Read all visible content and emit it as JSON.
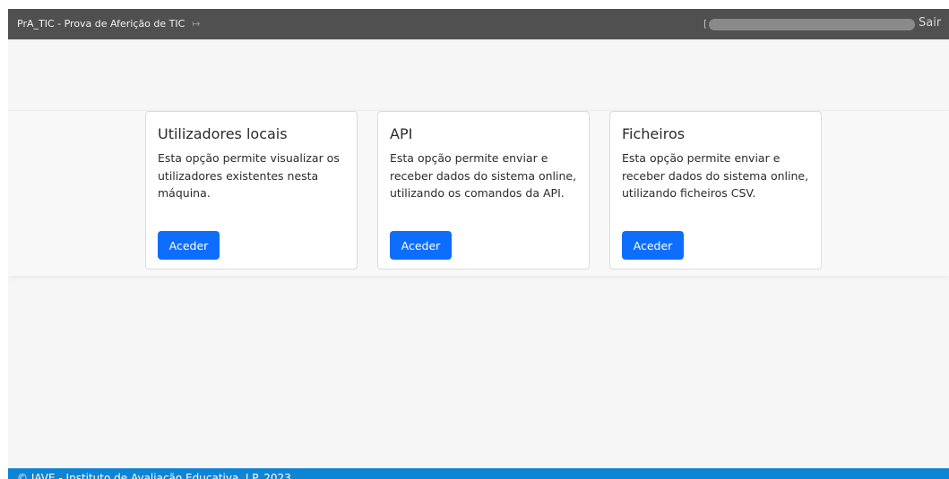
{
  "navbar": {
    "brand": "PrA_TIC - Prova de Aferição de TIC",
    "brand_icon": "sign-out-icon",
    "user_icon": "user-icon",
    "logout_label": "Sair"
  },
  "cards": [
    {
      "title": "Utilizadores locais",
      "text": "Esta opção permite visualizar os utilizadores existentes nesta máquina.",
      "button": "Aceder"
    },
    {
      "title": "API",
      "text": "Esta opção permite enviar e receber dados do sistema online, utilizando os comandos da API.",
      "button": "Aceder"
    },
    {
      "title": "Ficheiros",
      "text": "Esta opção permite enviar e receber dados do sistema online, utilizando ficheiros CSV.",
      "button": "Aceder"
    }
  ],
  "footer": {
    "text": "© IAVE - Instituto de Avaliação Educativa, I.P. 2023"
  },
  "colors": {
    "navbar": "#505050",
    "primary_button": "#0d6efd",
    "footer": "#0d84d6",
    "background": "#f6f6f6"
  }
}
